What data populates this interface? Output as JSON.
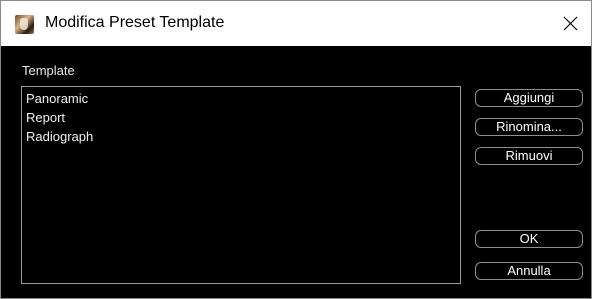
{
  "window": {
    "title": "Modifica Preset Template"
  },
  "template_group": {
    "label": "Template",
    "items": [
      {
        "label": "Panoramic"
      },
      {
        "label": "Report"
      },
      {
        "label": "Radiograph"
      }
    ]
  },
  "buttons": {
    "add_label": "Aggiungi",
    "rename_label": "Rinomina...",
    "remove_label": "Rimuovi",
    "ok_label": "OK",
    "cancel_label": "Annulla"
  },
  "icons": {
    "app": "app-icon",
    "close": "close-icon"
  },
  "colors": {
    "background": "#000000",
    "text": "#ffffff",
    "border": "#8f8f8f",
    "titlebar": "#ffffff"
  }
}
